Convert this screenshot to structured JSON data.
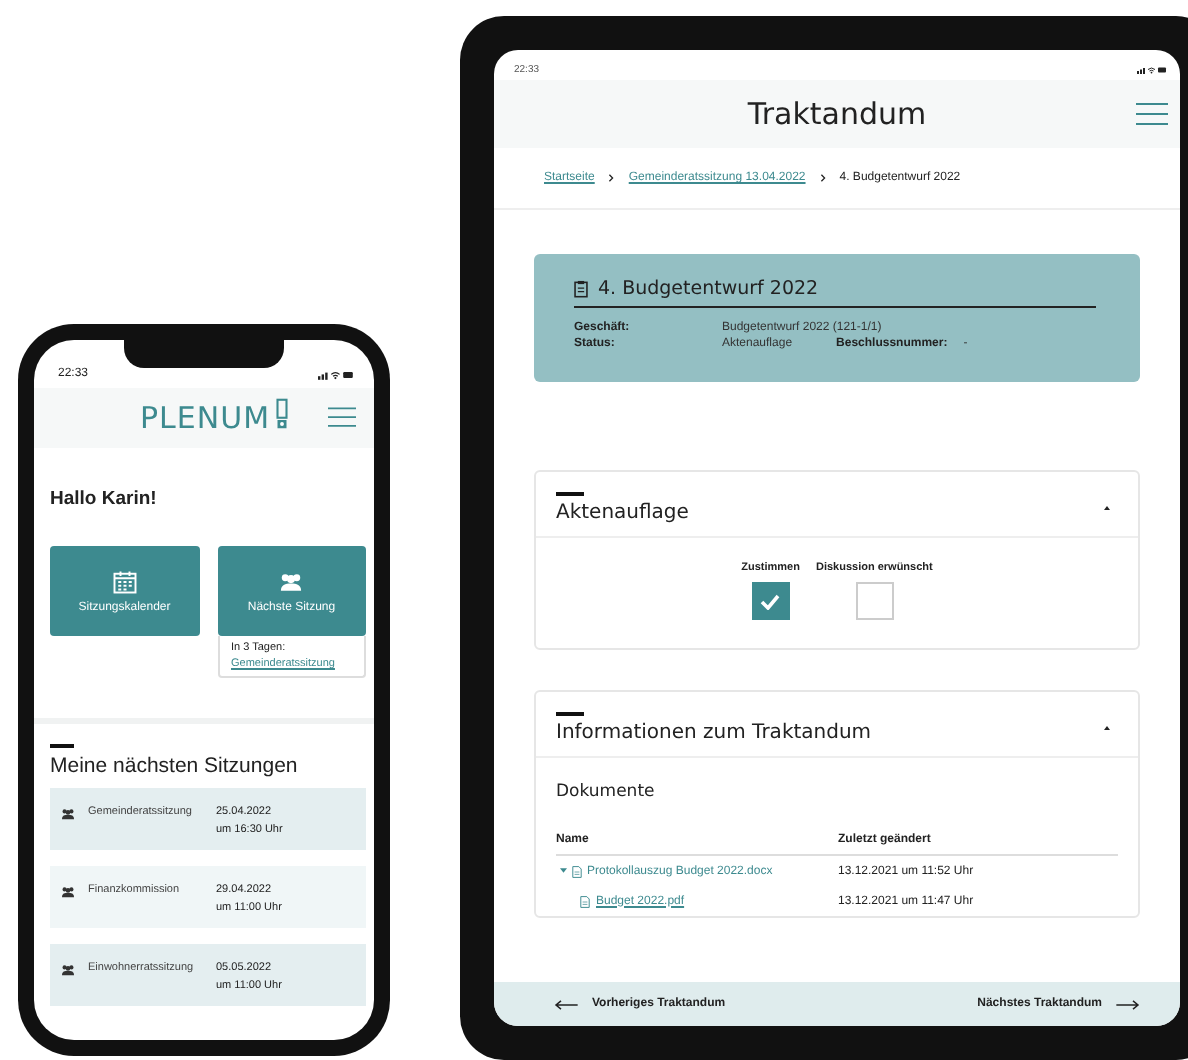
{
  "phone": {
    "status_time": "22:33",
    "logo": "PLENUM",
    "greeting": "Hallo Karin!",
    "tiles": [
      {
        "kind": "calendar",
        "label": "Sitzungskalender"
      },
      {
        "kind": "people",
        "label": "Nächste Sitzung",
        "note": "In 3 Tagen:",
        "link": "Gemeinderatssitzung"
      }
    ],
    "meetings": {
      "title": "Meine nächsten Sitzungen",
      "items": [
        {
          "name": "Gemeinderatssitzung",
          "date": "25.04.2022",
          "time": "um 16:30 Uhr"
        },
        {
          "name": "Finanzkommission",
          "date": "29.04.2022",
          "time": "um 11:00 Uhr"
        },
        {
          "name": "Einwohnerratssitzung",
          "date": "05.05.2022",
          "time": "um 11:00 Uhr"
        }
      ]
    }
  },
  "tablet": {
    "status_time": "22:33",
    "title": "Traktandum",
    "breadcrumb": [
      {
        "label": "Startseite",
        "link": true
      },
      {
        "label": "Gemeinderatssitzung 13.04.2022",
        "link": true
      },
      {
        "label": "4. Budgetentwurf 2022",
        "link": false
      }
    ],
    "item_card": {
      "title": "4. Budgetentwurf 2022",
      "rows": [
        [
          {
            "label": "Geschäft:",
            "value": "Budgetentwurf 2022 (121-1/1)"
          }
        ],
        [
          {
            "label": "Status:",
            "value": "Aktenauflage"
          },
          {
            "label": "Beschlussnummer:",
            "value": "-"
          }
        ]
      ]
    },
    "sections": [
      {
        "kind": "checkboxes",
        "title": "Aktenauflage",
        "expanded": true,
        "checkboxes": [
          {
            "label": "Zustimmen",
            "checked": true
          },
          {
            "label": "Diskussion erwünscht",
            "checked": false
          }
        ]
      },
      {
        "kind": "documents",
        "title": "Informationen zum Traktandum",
        "expanded": true,
        "subheading": "Dokumente",
        "columns": [
          "Name",
          "Zuletzt geändert"
        ],
        "rows": [
          {
            "name": "Protokollauszug Budget 2022.docx",
            "modified": "13.12.2021 um 11:52 Uhr",
            "expanded": true,
            "children": [
              {
                "name": "Budget 2022.pdf",
                "modified": "13.12.2021 um 11:47 Uhr"
              }
            ]
          }
        ]
      }
    ],
    "footer": {
      "previous": "Vorheriges Traktandum",
      "next": "Nächstes Traktandum"
    }
  }
}
